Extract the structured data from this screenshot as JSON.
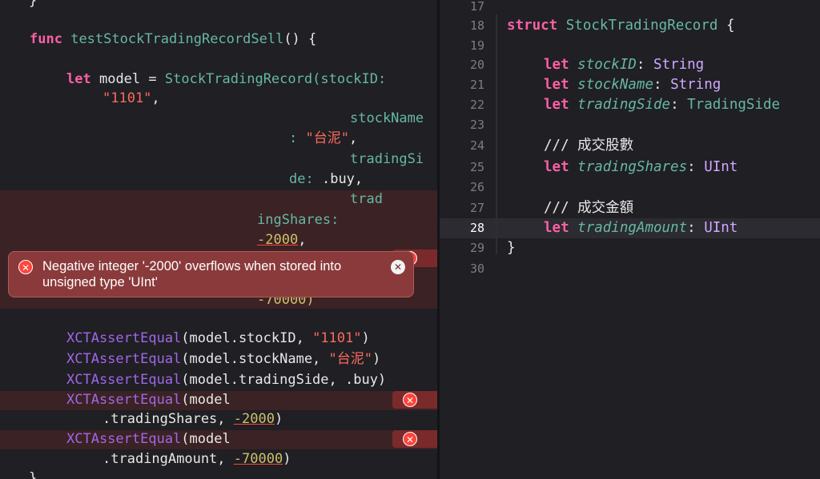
{
  "left_code": {
    "brace_top": "}",
    "func_kw": "func",
    "func_name": "testStockTradingRecordSell",
    "func_sig_tail": "() {",
    "let_kw": "let",
    "model_eq": "model =",
    "ctor_name": "StockTradingRecord",
    "arg1_label": "(stockID:",
    "arg1_value": "\"1101\"",
    "comma": ",",
    "arg2_label_a": "stockName",
    "arg2_label_b": ":",
    "arg2_value": "\"台泥\"",
    "arg3_label_a": "tradingSi",
    "arg3_label_b": "de:",
    "arg3_value": ".buy,",
    "arg4_label_a": "trad",
    "arg4_label_b": "ingShares:",
    "arg4_value": "-2000",
    "arg5_value": "-70000)",
    "assert1_fn": "XCTAssertEqual",
    "assert1_args": "(model.stockID, ",
    "assert1_str": "\"1101\"",
    "assert1_close": ")",
    "assert2_fn": "XCTAssertEqual",
    "assert2_args": "(model.stockName, ",
    "assert2_str": "\"台泥\"",
    "assert2_close": ")",
    "assert3_fn": "XCTAssertEqual",
    "assert3_args": "(model.tradingSide, .buy)",
    "assert4_fn": "XCTAssertEqual",
    "assert4_args": "(model",
    "assert4_cont": ".tradingShares, ",
    "assert4_num": "-2000",
    "assert4_close": ")",
    "assert5_fn": "XCTAssertEqual",
    "assert5_args": "(model",
    "assert5_cont": ".tradingAmount, ",
    "assert5_num": "-70000",
    "assert5_close": ")",
    "brace_bottom": "}"
  },
  "error_popup": {
    "message": "Negative integer '-2000' overflows when stored into unsigned type 'UInt'",
    "error_icon": "error-circle-icon",
    "close_icon": "close-icon"
  },
  "right_code": {
    "line_numbers": [
      "17",
      "18",
      "19",
      "20",
      "21",
      "22",
      "23",
      "24",
      "25",
      "26",
      "27",
      "28",
      "29",
      "30"
    ],
    "current_line": "28",
    "struct_kw": "struct",
    "struct_name": "StockTradingRecord",
    "struct_open": " {",
    "let_kw": "let",
    "f1_name": "stockID",
    "f1_type": "String",
    "f2_name": "stockName",
    "f2_type": "String",
    "f3_name": "tradingSide",
    "f3_type": "TradingSide",
    "c1": "/// 成交股數",
    "f4_name": "tradingShares",
    "f4_type": "UInt",
    "c2": "/// 成交金額",
    "f5_name": "tradingAmount",
    "f5_type": "UInt",
    "struct_close": "}"
  },
  "colors": {
    "background": "#1f1f24",
    "keyword": "#fc5fa3",
    "string": "#fc6a5d",
    "number": "#d0bf69",
    "type": "#d0a8ff",
    "error": "#ff453a"
  }
}
